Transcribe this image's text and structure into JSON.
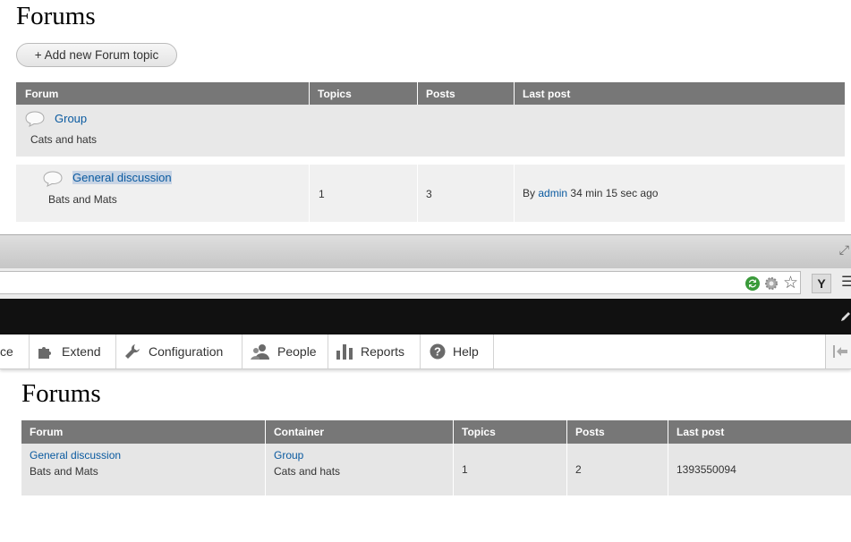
{
  "top": {
    "title": "Forums",
    "add_button": {
      "plus": "+",
      "label": "Add new Forum topic"
    },
    "table": {
      "headers": [
        "Forum",
        "Topics",
        "Posts",
        "Last post"
      ],
      "group_row": {
        "name": "Group",
        "description": "Cats and hats"
      },
      "forum_row": {
        "name": "General discussion",
        "description": "Bats and Mats",
        "topics": "1",
        "posts": "3",
        "last_post_prefix": "By",
        "last_post_user": "admin",
        "last_post_time": "34 min 15 sec ago"
      }
    }
  },
  "browser": {
    "y_button": "Y",
    "menu_glyph": "☰",
    "star_icon": "☆"
  },
  "toolbar": {
    "items": [
      {
        "label": "ce",
        "icon": ""
      },
      {
        "label": "Extend",
        "icon": "puzzle-icon"
      },
      {
        "label": "Configuration",
        "icon": "wrench-icon"
      },
      {
        "label": "People",
        "icon": "people-icon"
      },
      {
        "label": "Reports",
        "icon": "bar-chart-icon"
      },
      {
        "label": "Help",
        "icon": "help-icon"
      }
    ]
  },
  "bottom": {
    "title": "Forums",
    "table": {
      "headers": [
        "Forum",
        "Container",
        "Topics",
        "Posts",
        "Last post"
      ],
      "row": {
        "forum": "General discussion",
        "forum_description": "Bats and Mats",
        "container": "Group",
        "container_description": "Cats and hats",
        "topics": "1",
        "posts": "2",
        "last_post": "1393550094"
      }
    }
  },
  "colors": {
    "header_bg": "#777777",
    "link": "#0a5aa0",
    "dark_bar": "#111111"
  }
}
